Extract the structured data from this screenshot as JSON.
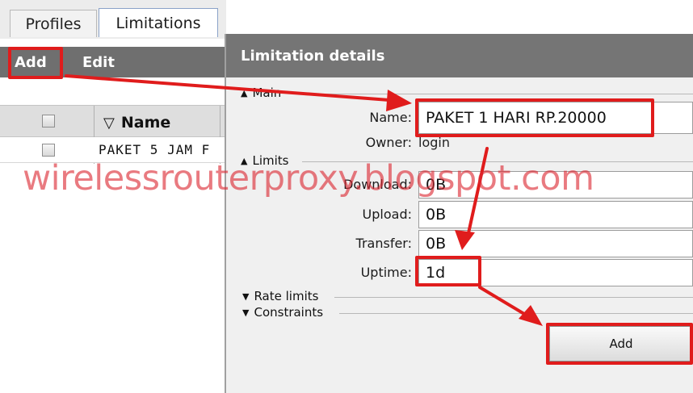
{
  "tabs": [
    {
      "label": "Profiles",
      "active": false
    },
    {
      "label": "Limitations",
      "active": true
    }
  ],
  "toolbar": {
    "add_label": "Add",
    "edit_label": "Edit"
  },
  "grid": {
    "header": {
      "name_label": "Name",
      "sort_icon": "sort-triangle-icon"
    },
    "rows": [
      {
        "name": "PAKET 5 JAM F"
      }
    ]
  },
  "dialog": {
    "title": "Limitation details",
    "sections": {
      "main": {
        "label": "Main",
        "expanded": true
      },
      "limits": {
        "label": "Limits",
        "expanded": true
      },
      "rate_limits": {
        "label": "Rate limits",
        "expanded": false
      },
      "constraints": {
        "label": "Constraints",
        "expanded": false
      }
    },
    "fields": {
      "name": {
        "label": "Name:",
        "value": "PAKET 1 HARI RP.20000"
      },
      "owner": {
        "label": "Owner:",
        "value": "login"
      },
      "download": {
        "label": "Download:",
        "value": "0B"
      },
      "upload": {
        "label": "Upload:",
        "value": "0B"
      },
      "transfer": {
        "label": "Transfer:",
        "value": "0B"
      },
      "uptime": {
        "label": "Uptime:",
        "value": "1d"
      }
    },
    "add_button_label": "Add"
  },
  "watermark": "wirelessrouterproxy.blogspot.com",
  "colors": {
    "highlight": "#e01c1c",
    "toolbar": "#6f6f6f",
    "title_bar": "#757575"
  }
}
